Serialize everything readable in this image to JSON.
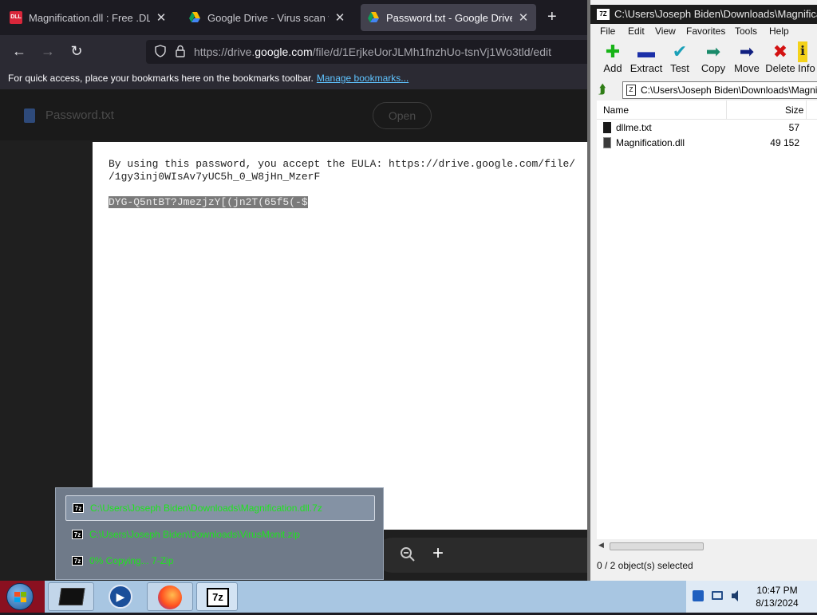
{
  "browser": {
    "tabs": [
      {
        "label": "Magnification.dll : Free .DLL do",
        "icon": "dll-icon",
        "active": false
      },
      {
        "label": "Google Drive - Virus scan warni",
        "icon": "drive-icon",
        "active": false
      },
      {
        "label": "Password.txt - Google Drive",
        "icon": "drive-icon",
        "active": true
      }
    ],
    "new_tab": "+",
    "url_prefix": "https://drive.",
    "url_domain": "google.com",
    "url_rest": "/file/d/1ErjkeUorJLMh1fnzhUo-tsnVj1Wo3tld/edit",
    "bookmark_hint": "For quick access, place your bookmarks here on the bookmarks toolbar.",
    "bookmark_link": "Manage bookmarks..."
  },
  "viewer": {
    "file_name": "Password.txt",
    "open_button": "Open",
    "line1": "By using this password, you accept the EULA: https://drive.google.com/file/",
    "line2": "/1gy3inj0WIsAv7yUC5h_0_W8jHn_MzerF",
    "selected_line": "DYG-Q5ntBT?JmezjzY[(jn2T(65f5(-$"
  },
  "zip": {
    "title": "C:\\Users\\Joseph Biden\\Downloads\\Magnification",
    "menu": [
      "File",
      "Edit",
      "View",
      "Favorites",
      "Tools",
      "Help"
    ],
    "toolbar": [
      {
        "label": "Add",
        "icon": "plus-icon",
        "glyph": "✚",
        "color": "#17b317"
      },
      {
        "label": "Extract",
        "icon": "minus-icon",
        "glyph": "▬",
        "color": "#1b2fa8"
      },
      {
        "label": "Test",
        "icon": "check-icon",
        "glyph": "✔",
        "color": "#1aa0b8"
      },
      {
        "label": "Copy",
        "icon": "copy-arrow-icon",
        "glyph": "➡",
        "color": "#1a8a6a"
      },
      {
        "label": "Move",
        "icon": "move-arrow-icon",
        "glyph": "➡",
        "color": "#101f80"
      },
      {
        "label": "Delete",
        "icon": "delete-icon",
        "glyph": "✖",
        "color": "#d31212"
      },
      {
        "label": "Info",
        "icon": "info-icon",
        "glyph": "ℹ",
        "color": "#222"
      }
    ],
    "path": "C:\\Users\\Joseph Biden\\Downloads\\Magnifi",
    "columns": {
      "name": "Name",
      "size": "Size"
    },
    "files": [
      {
        "name": "dllme.txt",
        "size": "57"
      },
      {
        "name": "Magnification.dll",
        "size": "49 152"
      }
    ],
    "status": "0 / 2 object(s) selected"
  },
  "jumplist": {
    "items": [
      "C:\\Users\\Joseph Biden\\Downloads\\Magnification.dll.7z",
      "C:\\Users\\Joseph Biden\\Downloads\\VirusMonit.zip",
      "0% Copying... 7-Zip"
    ]
  },
  "taskbar": {
    "time": "10:47 PM",
    "date": "8/13/2024"
  }
}
